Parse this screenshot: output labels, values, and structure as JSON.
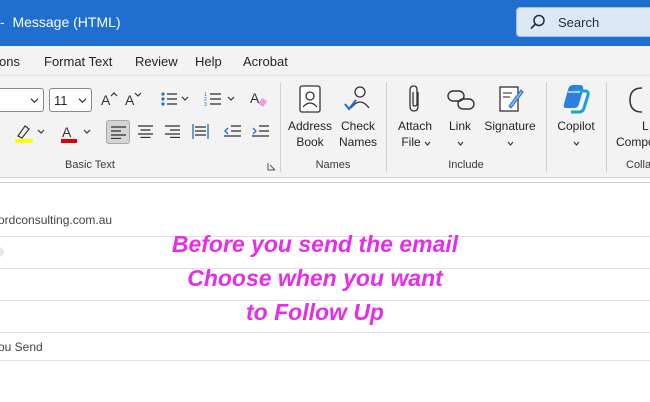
{
  "window": {
    "title": "-  Message (HTML)"
  },
  "search": {
    "label": "Search"
  },
  "menu": {
    "tabs": [
      "ons",
      "Format Text",
      "Review",
      "Help",
      "Acrobat"
    ]
  },
  "ribbon": {
    "font_size": "11",
    "groups": {
      "basic_text": "Basic Text",
      "names": "Names",
      "include": "Include",
      "collab": "Colla"
    },
    "buttons": {
      "address_book": [
        "Address",
        "Book"
      ],
      "check_names": [
        "Check",
        "Names"
      ],
      "attach_file": [
        "Attach",
        "File"
      ],
      "link": "Link",
      "signature": "Signature",
      "copilot": "Copilot",
      "loop": [
        "L",
        "Compo"
      ]
    },
    "colors": {
      "highlight": "#ffff00",
      "font_color": "#e00000",
      "copilot_accent": "#2f7fe0"
    }
  },
  "compose": {
    "from_value": "ordconsulting.com.au",
    "send_option": "ou Send"
  },
  "annotation": {
    "text": "Before you send the email\nChoose when you want\nto Follow Up",
    "color": "#e62ee6"
  }
}
